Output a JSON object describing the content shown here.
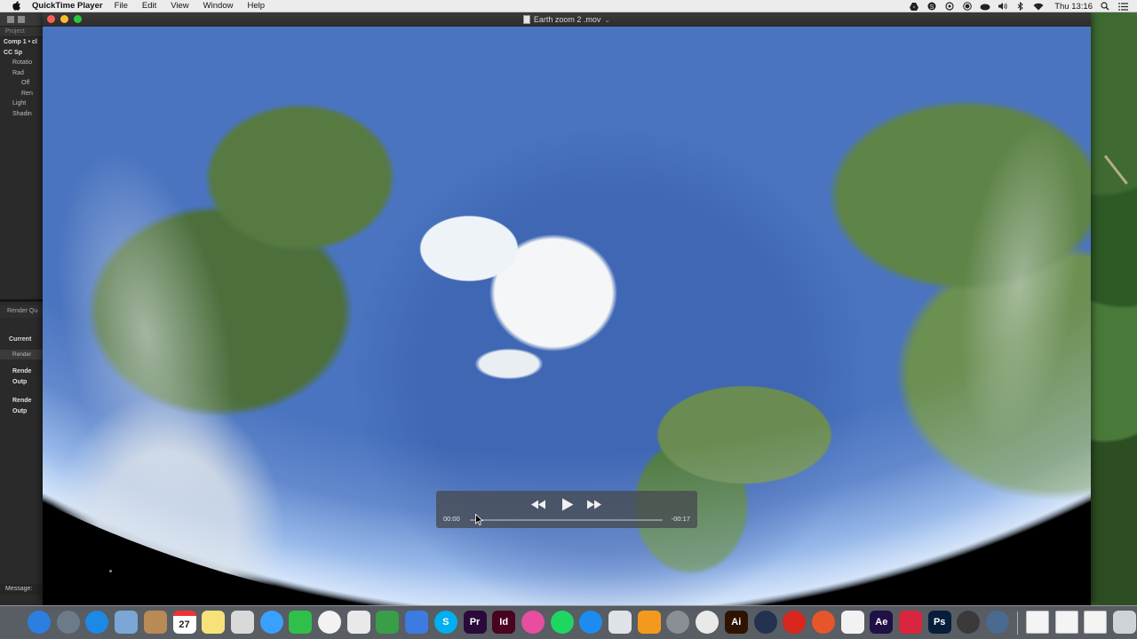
{
  "menubar": {
    "app_name": "QuickTime Player",
    "items": [
      "File",
      "Edit",
      "View",
      "Window",
      "Help"
    ],
    "clock": "Thu 13:16"
  },
  "after_effects": {
    "project_tab": "Project",
    "comp_line": "Comp 1 • cl",
    "layer_lines": [
      "CC Sp",
      "Rotatio",
      "Rad",
      "Off",
      "Ren",
      "Light",
      "Shadin"
    ],
    "render_queue_title": "Render Qu",
    "current_label": "Current",
    "render_header": "Render",
    "render_rows": [
      "Rende",
      "Outp",
      "Rende",
      "Outp"
    ],
    "message_label": "Message:"
  },
  "player": {
    "window_title": "Earth zoom 2 .mov",
    "elapsed": "00:00",
    "remaining": "-00:17",
    "progress": 0.0
  },
  "dock": {
    "items": [
      {
        "name": "finder-icon",
        "label": "",
        "color": "#2a7fe0"
      },
      {
        "name": "launchpad-icon",
        "label": "",
        "color": "#6c7a89"
      },
      {
        "name": "safari-icon",
        "label": "",
        "color": "#1e88e5"
      },
      {
        "name": "preview-icon",
        "label": "",
        "color": "#7aa7d6"
      },
      {
        "name": "contacts-icon",
        "label": "",
        "color": "#b88a55"
      },
      {
        "name": "calendar-icon",
        "label": "27",
        "color": "#ffffff"
      },
      {
        "name": "notes-icon",
        "label": "",
        "color": "#f7e27a"
      },
      {
        "name": "preview-photos-icon",
        "label": "",
        "color": "#d9d9d9"
      },
      {
        "name": "messages-icon",
        "label": "",
        "color": "#3aa0ff"
      },
      {
        "name": "facetime-icon",
        "label": "",
        "color": "#2fbf4a"
      },
      {
        "name": "photos-icon",
        "label": "",
        "color": "#f2f2f2"
      },
      {
        "name": "textedit-icon",
        "label": "",
        "color": "#e9e9e9"
      },
      {
        "name": "numbers-icon",
        "label": "",
        "color": "#3a9d48"
      },
      {
        "name": "keynote-icon",
        "label": "",
        "color": "#3d7be0"
      },
      {
        "name": "skype-icon",
        "label": "S",
        "color": "#00aff0"
      },
      {
        "name": "premiere-icon",
        "label": "Pr",
        "color": "#2a0a3a"
      },
      {
        "name": "indesign-icon",
        "label": "Id",
        "color": "#49021f"
      },
      {
        "name": "itunes-icon",
        "label": "",
        "color": "#e84ea0"
      },
      {
        "name": "spotify-icon",
        "label": "",
        "color": "#1ed760"
      },
      {
        "name": "app-store-icon",
        "label": "",
        "color": "#1d8cf0"
      },
      {
        "name": "script-editor-icon",
        "label": "",
        "color": "#dfe3e8"
      },
      {
        "name": "ibooks-icon",
        "label": "",
        "color": "#f39a1e"
      },
      {
        "name": "system-preferences-icon",
        "label": "",
        "color": "#8a8f96"
      },
      {
        "name": "chrome-icon",
        "label": "",
        "color": "#e9e9e9"
      },
      {
        "name": "illustrator-icon",
        "label": "Ai",
        "color": "#2e1400"
      },
      {
        "name": "cinema4d-icon",
        "label": "",
        "color": "#23324f"
      },
      {
        "name": "creative-cloud-icon",
        "label": "",
        "color": "#d8261f"
      },
      {
        "name": "firefox-icon",
        "label": "",
        "color": "#e6562a"
      },
      {
        "name": "google-drive-icon",
        "label": "",
        "color": "#f2f2f2"
      },
      {
        "name": "after-effects-icon",
        "label": "Ae",
        "color": "#1f1045"
      },
      {
        "name": "sketchup-icon",
        "label": "",
        "color": "#d7263d"
      },
      {
        "name": "photoshop-icon",
        "label": "Ps",
        "color": "#061e3a"
      },
      {
        "name": "quicktime-icon",
        "label": "",
        "color": "#3a3a3a"
      },
      {
        "name": "browser-icon",
        "label": "",
        "color": "#4a6b8f"
      },
      {
        "name": "document-stack-icon",
        "label": "",
        "color": "#f4f4f4"
      },
      {
        "name": "document-stack-icon-2",
        "label": "",
        "color": "#f4f4f4"
      },
      {
        "name": "document-stack-icon-3",
        "label": "",
        "color": "#f4f4f4"
      },
      {
        "name": "trash-icon",
        "label": "",
        "color": "#cfd3d8"
      }
    ]
  }
}
